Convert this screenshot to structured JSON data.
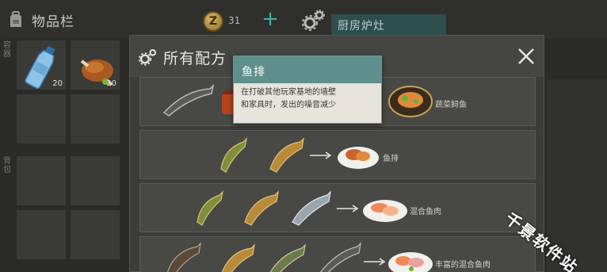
{
  "inventory": {
    "title": "物品栏",
    "side_labels": [
      "容器",
      "背包"
    ],
    "slots": [
      {
        "item": "water-bottle",
        "qty": "20"
      },
      {
        "item": "roast-chicken",
        "qty": "20"
      }
    ]
  },
  "topbar": {
    "coin_symbol": "Z",
    "coin_count": "31",
    "plus_label": "+",
    "station_label": "厨房炉灶"
  },
  "panel": {
    "title": "所有配方",
    "recipes": [
      {
        "name": "蔬菜鲟鱼"
      },
      {
        "name": "鱼排"
      },
      {
        "name": "混合鱼肉"
      },
      {
        "name": "丰富的混合鱼肉"
      }
    ]
  },
  "tooltip": {
    "title": "鱼排",
    "line1": "在打破其他玩家基地的墙壁",
    "line2": "和家具时，发出的噪音减少"
  },
  "watermark": "千景软件站",
  "colors": {
    "accent": "#3fb1a4",
    "tooltip_header": "#5f8f8d",
    "station_bg": "#2c4e4d"
  }
}
